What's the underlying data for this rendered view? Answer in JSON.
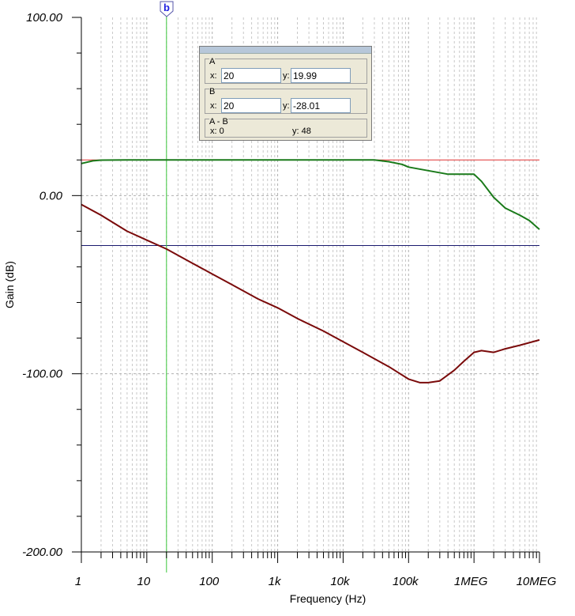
{
  "chart_data": {
    "type": "line",
    "xlabel": "Frequency (Hz)",
    "ylabel": "Gain (dB)",
    "xscale": "log",
    "xlim": [
      1,
      10000000
    ],
    "ylim": [
      -200,
      100
    ],
    "grid": true,
    "x_tick_labels": [
      "1",
      "10",
      "100",
      "1k",
      "10k",
      "100k",
      "1MEG",
      "10MEG"
    ],
    "y_tick_labels": [
      "100.00",
      "0.00",
      "-100.00",
      "-200.00"
    ],
    "series": [
      {
        "color": "#1a7a1a",
        "points": [
          [
            1,
            18
          ],
          [
            1.5,
            19.5
          ],
          [
            2,
            19.9
          ],
          [
            5,
            20
          ],
          [
            10,
            20
          ],
          [
            100,
            20
          ],
          [
            1000,
            20
          ],
          [
            10000,
            20
          ],
          [
            30000,
            20
          ],
          [
            50000,
            19
          ],
          [
            80000,
            17.5
          ],
          [
            100000,
            16
          ],
          [
            200000,
            14
          ],
          [
            400000,
            12
          ],
          [
            700000,
            12
          ],
          [
            1000000,
            12
          ],
          [
            1300000,
            8
          ],
          [
            2000000,
            -1
          ],
          [
            3000000,
            -7
          ],
          [
            5000000,
            -11
          ],
          [
            7000000,
            -14
          ],
          [
            10000000,
            -19
          ]
        ]
      },
      {
        "color": "#7a0a0a",
        "points": [
          [
            1,
            -5
          ],
          [
            2,
            -11
          ],
          [
            5,
            -20
          ],
          [
            10,
            -25
          ],
          [
            20,
            -30
          ],
          [
            50,
            -38
          ],
          [
            100,
            -44
          ],
          [
            200,
            -50
          ],
          [
            500,
            -58
          ],
          [
            1000,
            -63
          ],
          [
            2000,
            -69
          ],
          [
            5000,
            -76
          ],
          [
            10000,
            -82
          ],
          [
            20000,
            -88
          ],
          [
            50000,
            -96
          ],
          [
            100000,
            -103
          ],
          [
            150000,
            -105
          ],
          [
            200000,
            -105
          ],
          [
            300000,
            -104
          ],
          [
            500000,
            -98
          ],
          [
            700000,
            -93
          ],
          [
            1000000,
            -88
          ],
          [
            1300000,
            -87
          ],
          [
            2000000,
            -88
          ],
          [
            3000000,
            -86
          ],
          [
            5000000,
            -84
          ],
          [
            10000000,
            -81
          ]
        ]
      }
    ],
    "reference_lines": [
      {
        "axis": "y",
        "value": 19.99,
        "color": "#e03030"
      },
      {
        "axis": "y",
        "value": -28.01,
        "color": "#1a1a6e"
      },
      {
        "axis": "x",
        "value": 20,
        "color": "#3cc83c"
      }
    ]
  },
  "cursor_marker": {
    "label": "b",
    "color": "#2020e0"
  },
  "cursor_panel": {
    "a": {
      "label": "A",
      "x_label": "x:",
      "x_value": "20",
      "y_label": "y:",
      "y_value": "19.99"
    },
    "b": {
      "label": "B",
      "x_label": "x:",
      "x_value": "20",
      "y_label": "y:",
      "y_value": "-28.01"
    },
    "diff": {
      "label": "A - B",
      "x_text": "x:  0",
      "y_text": "y: 48"
    }
  }
}
